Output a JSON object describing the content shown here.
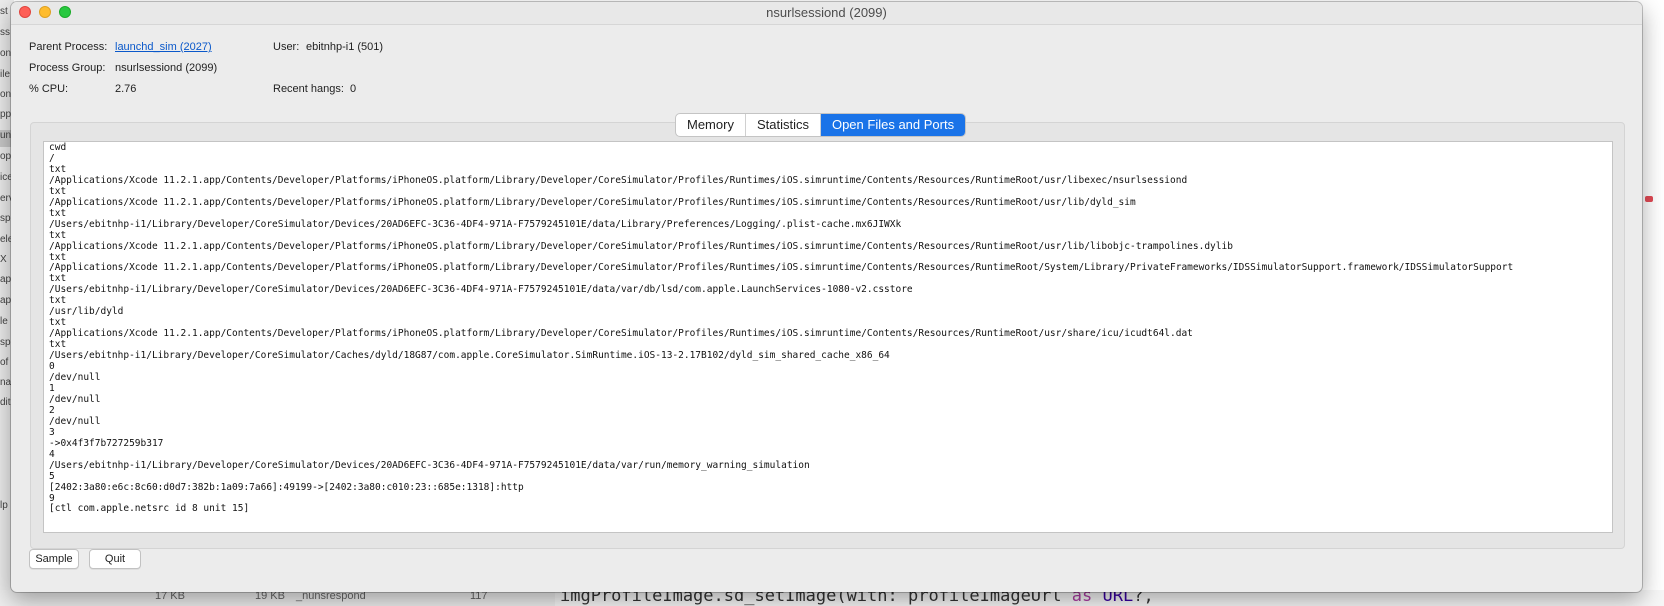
{
  "window": {
    "title": "nsurlsessiond (2099)"
  },
  "info": {
    "parent_process_label": "Parent Process:",
    "parent_process_value": "launchd_sim (2027)",
    "user_label": "User:",
    "user_value": "ebitnhp-i1 (501)",
    "process_group_label": "Process Group:",
    "process_group_value": "nsurlsessiond (2099)",
    "cpu_label": "% CPU:",
    "cpu_value": "2.76",
    "recent_hangs_label": "Recent hangs:",
    "recent_hangs_value": "0"
  },
  "tabs": [
    "Memory",
    "Statistics",
    "Open Files and Ports"
  ],
  "active_tab": "Open Files and Ports",
  "open_files": [
    "cwd",
    "/",
    "txt",
    "/Applications/Xcode 11.2.1.app/Contents/Developer/Platforms/iPhoneOS.platform/Library/Developer/CoreSimulator/Profiles/Runtimes/iOS.simruntime/Contents/Resources/RuntimeRoot/usr/libexec/nsurlsessiond",
    "txt",
    "/Applications/Xcode 11.2.1.app/Contents/Developer/Platforms/iPhoneOS.platform/Library/Developer/CoreSimulator/Profiles/Runtimes/iOS.simruntime/Contents/Resources/RuntimeRoot/usr/lib/dyld_sim",
    "txt",
    "/Users/ebitnhp-i1/Library/Developer/CoreSimulator/Devices/20AD6EFC-3C36-4DF4-971A-F7579245101E/data/Library/Preferences/Logging/.plist-cache.mx6JIWXk",
    "txt",
    "/Applications/Xcode 11.2.1.app/Contents/Developer/Platforms/iPhoneOS.platform/Library/Developer/CoreSimulator/Profiles/Runtimes/iOS.simruntime/Contents/Resources/RuntimeRoot/usr/lib/libobjc-trampolines.dylib",
    "txt",
    "/Applications/Xcode 11.2.1.app/Contents/Developer/Platforms/iPhoneOS.platform/Library/Developer/CoreSimulator/Profiles/Runtimes/iOS.simruntime/Contents/Resources/RuntimeRoot/System/Library/PrivateFrameworks/IDSSimulatorSupport.framework/IDSSimulatorSupport",
    "txt",
    "/Users/ebitnhp-i1/Library/Developer/CoreSimulator/Devices/20AD6EFC-3C36-4DF4-971A-F7579245101E/data/var/db/lsd/com.apple.LaunchServices-1080-v2.csstore",
    "txt",
    "/usr/lib/dyld",
    "txt",
    "/Applications/Xcode 11.2.1.app/Contents/Developer/Platforms/iPhoneOS.platform/Library/Developer/CoreSimulator/Profiles/Runtimes/iOS.simruntime/Contents/Resources/RuntimeRoot/usr/share/icu/icudt64l.dat",
    "txt",
    "/Users/ebitnhp-i1/Library/Developer/CoreSimulator/Caches/dyld/18G87/com.apple.CoreSimulator.SimRuntime.iOS-13-2.17B102/dyld_sim_shared_cache_x86_64",
    "0",
    "/dev/null",
    "1",
    "/dev/null",
    "2",
    "/dev/null",
    "3",
    "->0x4f3f7b727259b317",
    "4",
    "/Users/ebitnhp-i1/Library/Developer/CoreSimulator/Devices/20AD6EFC-3C36-4DF4-971A-F7579245101E/data/var/run/memory_warning_simulation",
    "5",
    "[2402:3a80:e6c:8c60:d0d7:382b:1a09:7a66]:49199->[2402:3a80:c010:23::685e:1318]:http",
    "9",
    "[ctl com.apple.netsrc id 8 unit 15]"
  ],
  "buttons": {
    "sample": "Sample",
    "quit": "Quit"
  },
  "background": {
    "left_items": [
      "st",
      "ss",
      "on",
      "ile",
      "on",
      "pp",
      "un",
      "op",
      "ice",
      "erv",
      "sp",
      "ele",
      "X",
      "ap",
      "ap",
      "le",
      "sp",
      "of",
      "na",
      "dit",
      "lp"
    ],
    "bottom_row": [
      "17 KB",
      "19 KB",
      "_nunsrespond",
      "117"
    ],
    "code_tokens": {
      "a": "imgProfileImage.sd_setImage(with: profileImageUrl ",
      "kw": "as",
      "b": " ",
      "ty": "URL",
      "c": "?,"
    }
  },
  "colors": {
    "accent": "#1a73e8",
    "link": "#0a58ca",
    "close": "#fe5f57",
    "minimize": "#febc2e",
    "zoom": "#28c840"
  }
}
